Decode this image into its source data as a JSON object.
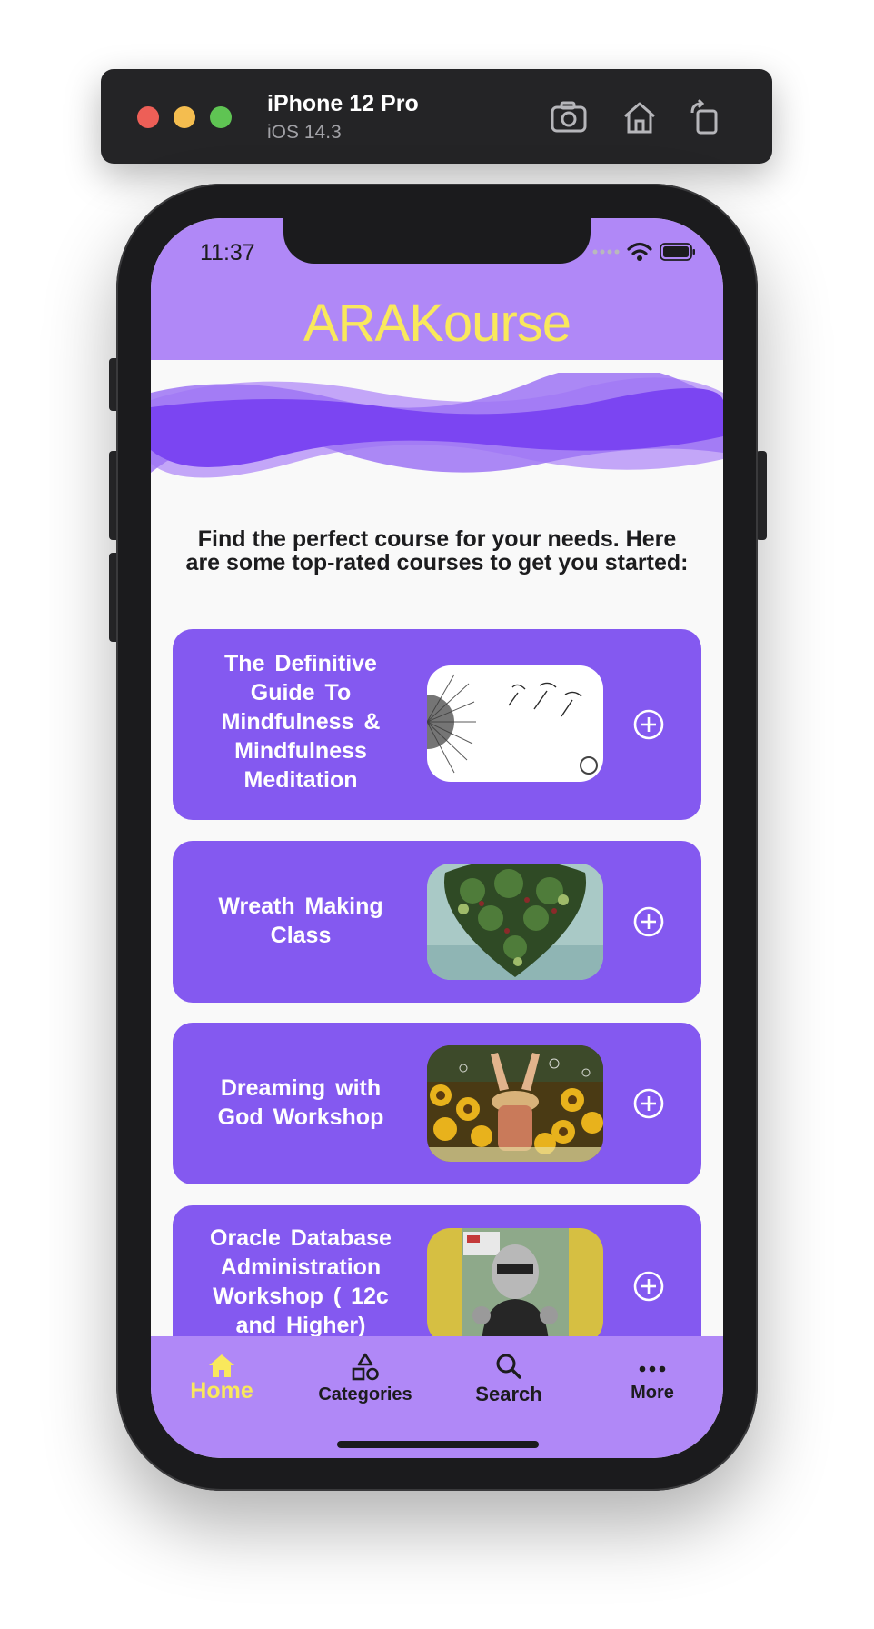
{
  "simulator": {
    "device_name": "iPhone 12 Pro",
    "os_version": "iOS 14.3",
    "icons": [
      "screenshot-icon",
      "home-icon",
      "rotate-icon"
    ]
  },
  "status_bar": {
    "time": "11:37",
    "icons": [
      "signal-icon",
      "wifi-icon",
      "battery-icon"
    ]
  },
  "header": {
    "title": "ARAKourse"
  },
  "intro": {
    "text": "Find the perfect course for your needs. Here are some top-rated courses to get you started:"
  },
  "courses": [
    {
      "title": "The Definitive Guide To Mindfulness & Mindfulness Meditation",
      "image": "dandelion-seeds-image"
    },
    {
      "title": "Wreath Making Class",
      "image": "green-wreath-image"
    },
    {
      "title": "Dreaming with God Workshop",
      "image": "sunflower-field-image"
    },
    {
      "title": "Oracle Database Administration Workshop ( 12c and Higher)",
      "image": "oracle-instructor-image"
    }
  ],
  "tab_bar": {
    "tabs": [
      {
        "label": "Home",
        "icon": "home-icon",
        "active": true
      },
      {
        "label": "Categories",
        "icon": "shapes-icon",
        "active": false
      },
      {
        "label": "Search",
        "icon": "search-icon",
        "active": false
      },
      {
        "label": "More",
        "icon": "ellipsis-icon",
        "active": false
      }
    ]
  },
  "colors": {
    "header_purple": "#b088f7",
    "card_purple": "#8459f0",
    "title_yellow": "#f9e85c"
  }
}
